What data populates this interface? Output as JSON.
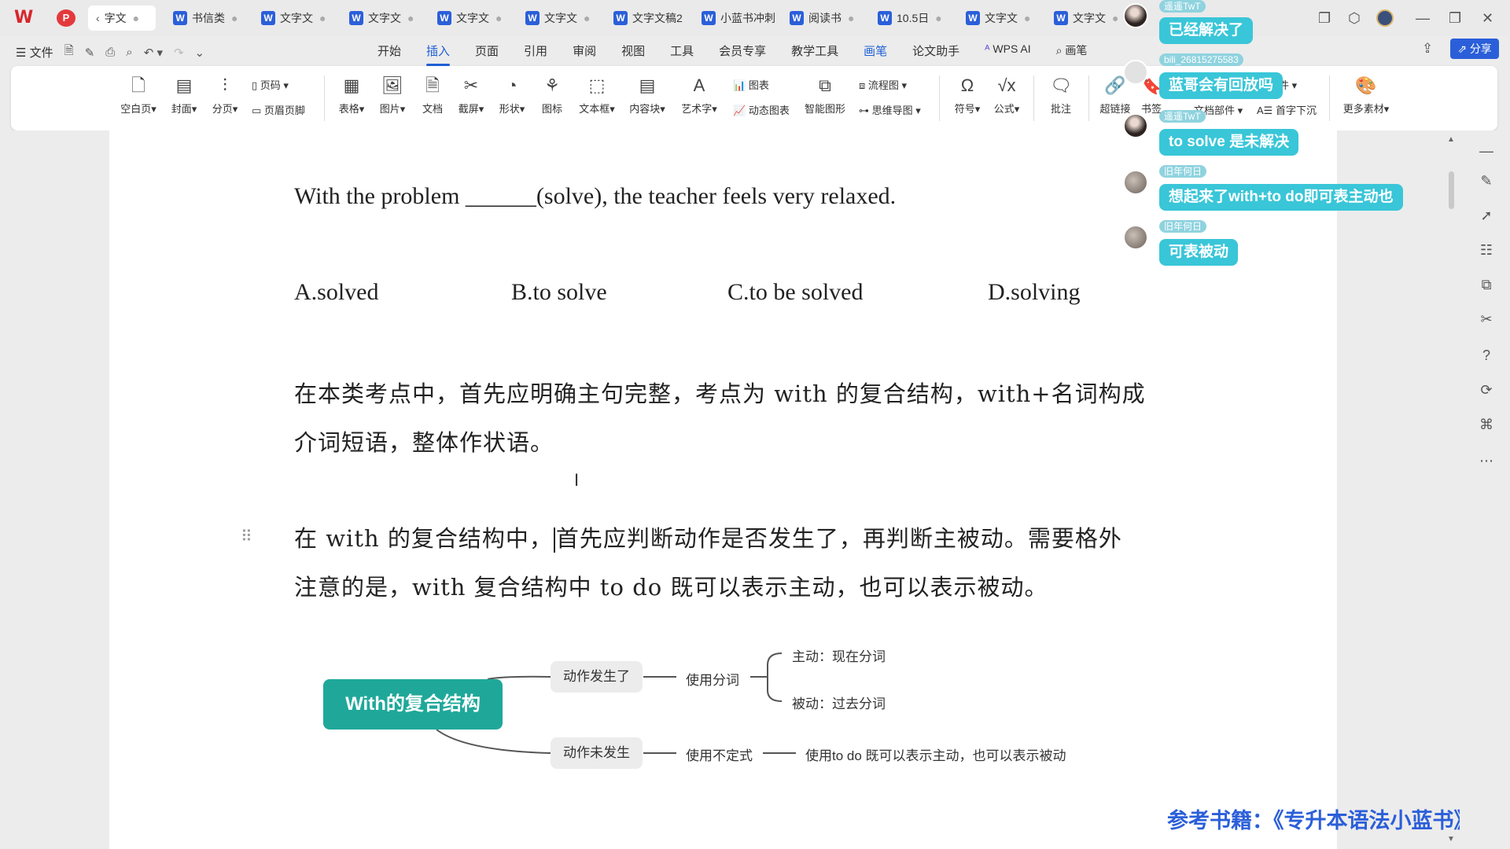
{
  "tabbar": {
    "tabs": [
      {
        "label": "字文"
      },
      {
        "label": "书信类"
      },
      {
        "label": "文字文"
      },
      {
        "label": "文字文"
      },
      {
        "label": "文字文"
      },
      {
        "label": "文字文"
      },
      {
        "label": "文字文稿2"
      },
      {
        "label": "小蓝书冲刺"
      },
      {
        "label": "阅读书"
      },
      {
        "label": "10.5日"
      },
      {
        "label": "文字文"
      },
      {
        "label": "文字文"
      }
    ]
  },
  "menubar": {
    "file_label": "文件",
    "tabs": [
      "开始",
      "插入",
      "页面",
      "引用",
      "审阅",
      "视图",
      "工具",
      "会员专享",
      "教学工具",
      "画笔",
      "论文助手"
    ],
    "wps_ai_label": "WPS AI",
    "search_label": "画笔",
    "share_label": "分享"
  },
  "ribbon": {
    "blank_page": "空白页",
    "cover": "封面",
    "page_break": "分页",
    "page_number": "页码",
    "header_footer": "页眉页脚",
    "table": "表格",
    "picture": "图片",
    "document": "文档",
    "screenshot": "截屏",
    "shape": "形状",
    "icon": "图标",
    "textbox": "文本框",
    "content_block": "内容块",
    "wordart": "艺术字",
    "chart": "图表",
    "dynamic_chart": "动态图表",
    "smart_shape": "智能图形",
    "flowchart": "流程图",
    "mindmap": "思维导图",
    "symbol": "符号",
    "formula": "公式",
    "comment": "批注",
    "hyperlink": "超链接",
    "bookmark": "书签",
    "doc_parts": "文档部件",
    "drop_cap": "首字下沉",
    "more_material": "更多素材",
    "parts_partial": "件"
  },
  "document": {
    "question": "With the problem ______(solve), the teacher feels very relaxed.",
    "options": [
      "A.solved",
      "B.to solve",
      "C.to be solved",
      "D.solving"
    ],
    "para1_line1": "在本类考点中，首先应明确主句完整，考点为 with 的复合结构，with+名词构成",
    "para1_line2": "介词短语，整体作状语。",
    "para2_line1_a": "在 with 的复合结构中，",
    "para2_line1_b": "首先应判断动作是否发生了，再判断主被动。需要格外",
    "para2_line2": "注意的是，with 复合结构中 to do 既可以表示主动，也可以表示被动。"
  },
  "mindmap": {
    "root": "With的复合结构",
    "branch_happened": "动作发生了",
    "use_participle": "使用分词",
    "active_present": "主动：现在分词",
    "passive_past": "被动：过去分词",
    "branch_not_happened": "动作未发生",
    "use_infinitive": "使用不定式",
    "infinitive_note": "使用to do 既可以表示主动，也可以表示被动"
  },
  "reference": "参考书籍：《专升本语法小蓝书》",
  "chat": [
    {
      "user": "遥遥TwT",
      "message": "已经解决了"
    },
    {
      "user": "bili_26815275583",
      "message": "蓝哥会有回放吗"
    },
    {
      "user": "遥遥TwT",
      "message": "to solve 是未解决"
    },
    {
      "user": "旧年何日",
      "message": "想起来了with+to do即可表主动也"
    },
    {
      "user": "旧年何日",
      "message": "可表被动"
    }
  ],
  "colors": {
    "accent": "#1f5fd6",
    "mindmap_root": "#1fa89a",
    "chat_bubble": "#39c6d8",
    "reference_text": "#2b5fd9"
  }
}
